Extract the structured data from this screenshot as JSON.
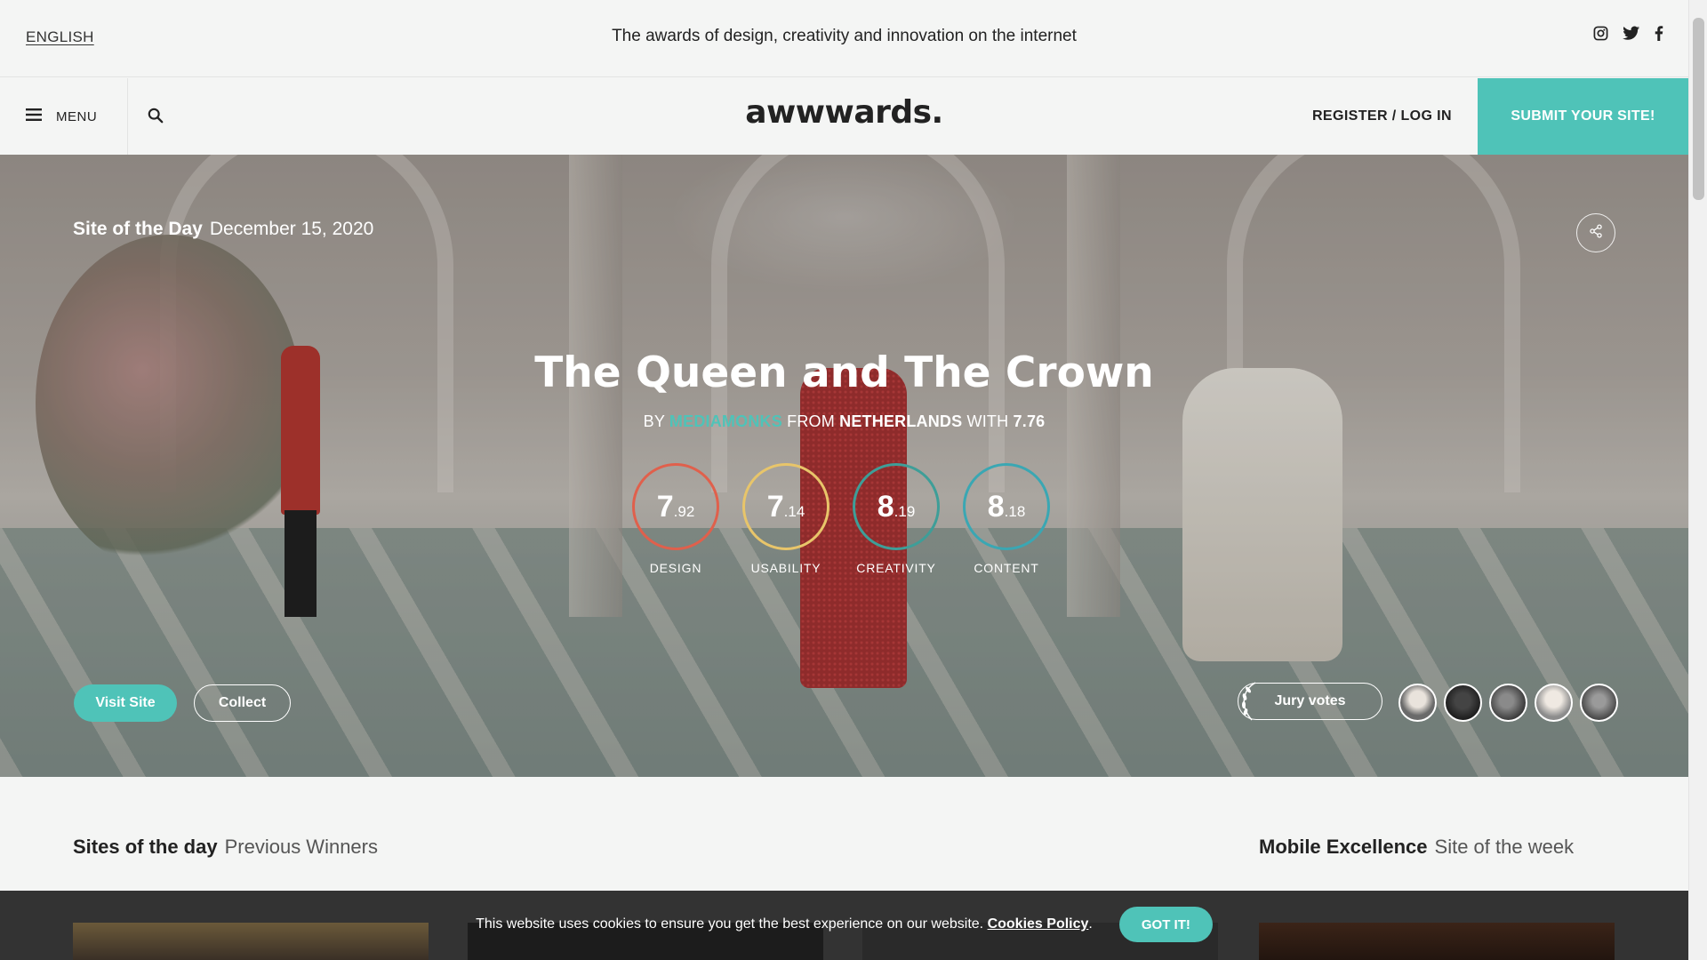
{
  "topbar": {
    "language": "ENGLISH",
    "tagline": "The awards of design, creativity and innovation on the internet"
  },
  "nav": {
    "menu_label": "MENU",
    "logo": "awwwards.",
    "login": "REGISTER / LOG IN",
    "submit": "SUBMIT YOUR SITE!"
  },
  "hero": {
    "award_label": "Site of the Day",
    "date": "December 15, 2020",
    "title": "The Queen and The Crown",
    "by": "BY",
    "studio": "MEDIAMONKS",
    "from": "FROM",
    "country": "NETHERLANDS",
    "with": "WITH",
    "score": "7.76",
    "scores": [
      {
        "whole": "7",
        "decimal": ".92",
        "label": "DESIGN",
        "color": "#e0604c"
      },
      {
        "whole": "7",
        "decimal": ".14",
        "label": "USABILITY",
        "color": "#e8c56a"
      },
      {
        "whole": "8",
        "decimal": ".19",
        "label": "CREATIVITY",
        "color": "#3e9e98"
      },
      {
        "whole": "8",
        "decimal": ".18",
        "label": "CONTENT",
        "color": "#3aa7b3"
      }
    ],
    "visit_label": "Visit Site",
    "collect_label": "Collect",
    "jury_label": "Jury votes"
  },
  "sections": {
    "left_title": "Sites of the day",
    "left_sub": "Previous Winners",
    "right_title": "Mobile Excellence",
    "right_sub": "Site of the week"
  },
  "cookie": {
    "text": "This website uses cookies to ensure you get the best experience on our website.",
    "link": "Cookies Policy",
    "period": ".",
    "button": "GOT IT!"
  },
  "colors": {
    "accent": "#4fc3b8"
  }
}
